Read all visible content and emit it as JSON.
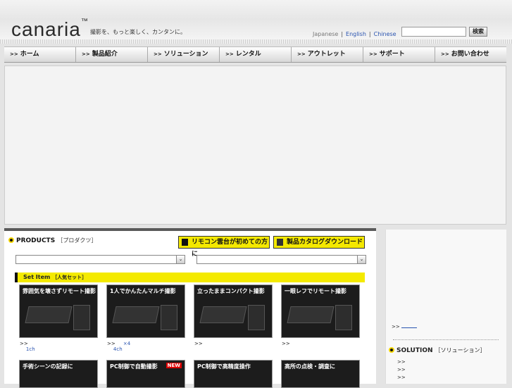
{
  "header": {
    "logo": "canaria",
    "logo_tm": "™",
    "tagline": "撮影を、もっと楽しく、カンタンに。",
    "languages": [
      "Japanese",
      "English",
      "Chinese"
    ],
    "search_button": "検索"
  },
  "nav": [
    "ホーム",
    "製品紹介",
    "ソリューション",
    "レンタル",
    "アウトレット",
    "サポート",
    "お問い合わせ"
  ],
  "products": {
    "title": "PRODUCTS",
    "subtitle": "［プロダクツ］",
    "beginner_button": "リモコン雲台が初めての方に",
    "catalog_button": "製品カタログダウンロード",
    "set_title": "Set Item",
    "set_subtitle": "［人気セット］",
    "cards": [
      {
        "caption": "雰囲気を壊さずリモート撮影",
        "link": "1ch",
        "extra": ""
      },
      {
        "caption": "1人でかんたんマルチ撮影",
        "link": "4ch",
        "extra": "×4"
      },
      {
        "caption": "立ったままコンパクト撮影",
        "link": "",
        "extra": ""
      },
      {
        "caption": "一眼レフでリモート撮影",
        "link": "",
        "extra": ""
      },
      {
        "caption": "手術シーンの記録に",
        "badge": ""
      },
      {
        "caption": "PC制御で自動撮影",
        "badge": "NEW"
      },
      {
        "caption": "PC制御で高精度操作",
        "badge": ""
      },
      {
        "caption": "高所の点検・調査に",
        "badge": ""
      }
    ]
  },
  "sidebar": {
    "solution_title": "SOLUTION",
    "solution_subtitle": "［ソリューション］"
  },
  "glyphs": {
    "arrow": ">>",
    "select_arrow": "⌄"
  }
}
